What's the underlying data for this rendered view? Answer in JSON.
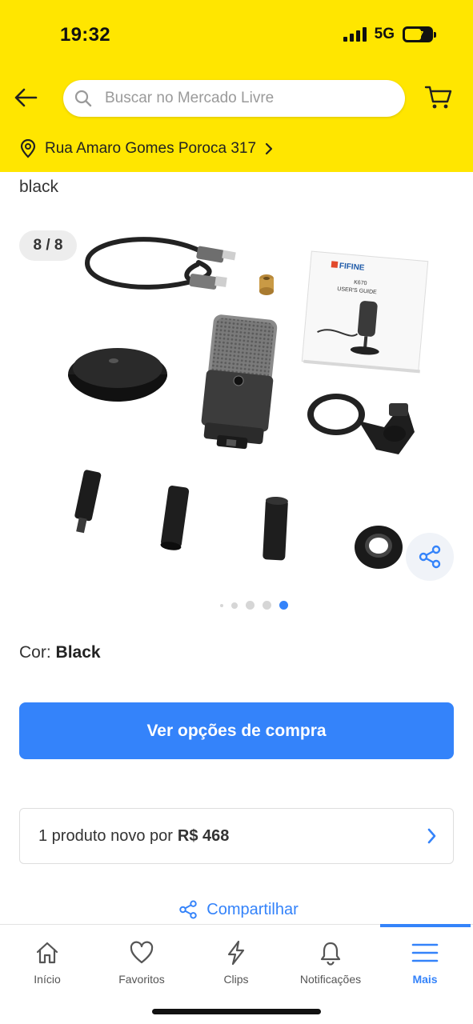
{
  "status_bar": {
    "time": "19:32",
    "network": "5G",
    "battery": "37"
  },
  "header": {
    "search_placeholder": "Buscar no Mercado Livre",
    "address": "Rua Amaro Gomes Poroca 317"
  },
  "product": {
    "variant_text": "black",
    "gallery": {
      "counter": "8 / 8",
      "current_index": 8,
      "total": 8,
      "box_label_brand": "FIFINE",
      "box_label_model": "K670",
      "box_label_title": "USER'S GUIDE"
    },
    "color_label": "Cor:",
    "color_value": "Black",
    "buy_button": "Ver opções de compra",
    "offer": {
      "label": "1 produto novo por",
      "price": "R$ 468"
    },
    "share_label": "Compartilhar"
  },
  "bottom_nav": {
    "items": [
      {
        "label": "Início",
        "icon": "home-icon"
      },
      {
        "label": "Favoritos",
        "icon": "heart-icon"
      },
      {
        "label": "Clips",
        "icon": "lightning-icon"
      },
      {
        "label": "Notificações",
        "icon": "bell-icon"
      },
      {
        "label": "Mais",
        "icon": "menu-icon",
        "active": true
      }
    ]
  },
  "colors": {
    "brand_yellow": "#FFE600",
    "accent_blue": "#3483FA"
  }
}
